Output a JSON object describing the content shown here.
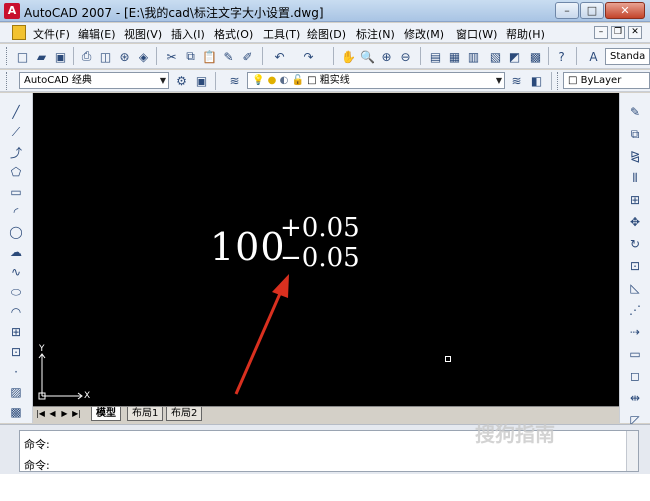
{
  "title": "AutoCAD 2007 - [E:\\我的cad\\标注文字大小设置.dwg]",
  "window_controls": {
    "minimize": "–",
    "maximize": "□",
    "close": "✕"
  },
  "menu": [
    "文件(F)",
    "编辑(E)",
    "视图(V)",
    "插入(I)",
    "格式(O)",
    "工具(T)",
    "绘图(D)",
    "标注(N)",
    "修改(M)",
    "窗口(W)",
    "帮助(H)"
  ],
  "mdi_controls": {
    "minimize": "–",
    "restore": "❐",
    "close": "✕"
  },
  "toolbar2": {
    "workspace": "AutoCAD 经典",
    "layer": "粗实线",
    "bylayer": "ByLayer",
    "text_style": "Standa"
  },
  "drawing": {
    "main_text": "100",
    "upper_tolerance": "+0.05",
    "lower_tolerance": "−0.05",
    "axis_y": "Y",
    "axis_x": "X"
  },
  "tabs": {
    "model": "模型",
    "layout1": "布局1",
    "layout2": "布局2"
  },
  "command": {
    "line1": "命令:",
    "line2": "命令:"
  },
  "watermark": "搜狗指南",
  "colors": {
    "arrow": "#d9301f",
    "canvas": "#000000",
    "text": "#ffffff"
  }
}
